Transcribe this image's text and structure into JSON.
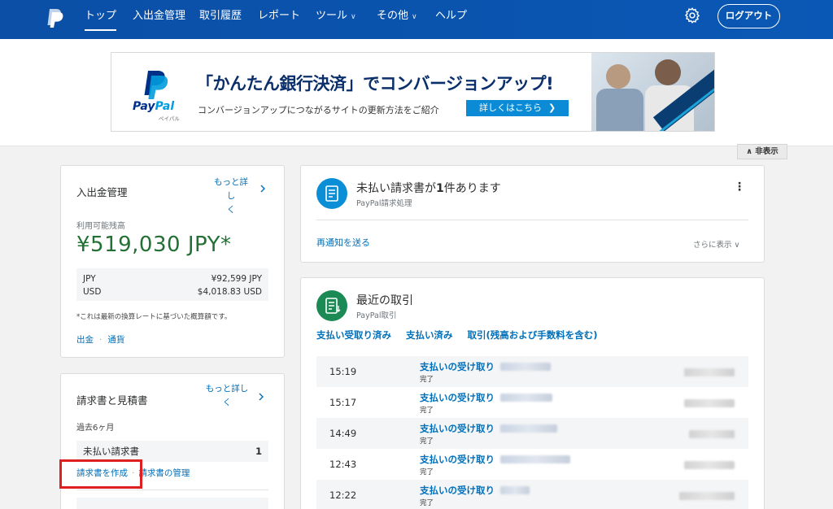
{
  "nav": {
    "items": [
      {
        "label": "トップ",
        "active": true
      },
      {
        "label": "入出金管理"
      },
      {
        "label": "取引履歴"
      },
      {
        "label": "レポート"
      },
      {
        "label": "ツール"
      },
      {
        "label": "その他"
      },
      {
        "label": "ヘルプ"
      }
    ],
    "logout_label": "ログアウト"
  },
  "banner": {
    "brand": "PayPal",
    "brand_kana": "ペイパル",
    "headline": "「かんたん銀行決済」でコンバージョンアップ!",
    "subtext": "コンバージョンアップにつながるサイトの更新方法をご紹介",
    "cta": "詳しくはこちら"
  },
  "hide_label": "非表示",
  "balance": {
    "title": "入出金管理",
    "more_line1": "もっと詳し",
    "more_line2": "く",
    "available_label": "利用可能残高",
    "amount": "¥519,030 JPY*",
    "currencies": [
      {
        "code": "JPY",
        "value": "¥92,599 JPY"
      },
      {
        "code": "USD",
        "value": "$4,018.83 USD"
      }
    ],
    "note": "*これは最新の換算レートに基づいた概算額です。",
    "withdraw": "出金",
    "currency_link": "通貨"
  },
  "invoices": {
    "title": "請求書と見積書",
    "more_line1": "もっと詳し",
    "more_line2": "く",
    "period": "過去6ヶ月",
    "unpaid_label": "未払い請求書",
    "unpaid_count": "1",
    "create": "請求書を作成",
    "manage": "請求書の管理"
  },
  "unpaid_card": {
    "title_prefix": "未払い請求書が",
    "count": "1",
    "title_suffix": "件あります",
    "subtitle": "PayPal請求処理",
    "resend": "再通知を送る",
    "show_more": "さらに表示"
  },
  "recent": {
    "title": "最近の取引",
    "subtitle": "PayPal取引",
    "tabs": [
      "支払い受取り済み",
      "支払い済み",
      "取引(残高および手数料を含む)"
    ],
    "rows": [
      {
        "time": "15:19",
        "type": "支払いの受け取り",
        "status": "完了"
      },
      {
        "time": "15:17",
        "type": "支払いの受け取り",
        "status": "完了"
      },
      {
        "time": "14:49",
        "type": "支払いの受け取り",
        "status": "完了"
      },
      {
        "time": "12:43",
        "type": "支払いの受け取り",
        "status": "完了"
      },
      {
        "time": "12:22",
        "type": "支払いの受け取り",
        "status": "完了"
      }
    ]
  },
  "colors": {
    "header_blue": "#0a4fa8",
    "link_blue": "#0070ba",
    "balance_green": "#227033",
    "highlight_red": "#e02020"
  }
}
